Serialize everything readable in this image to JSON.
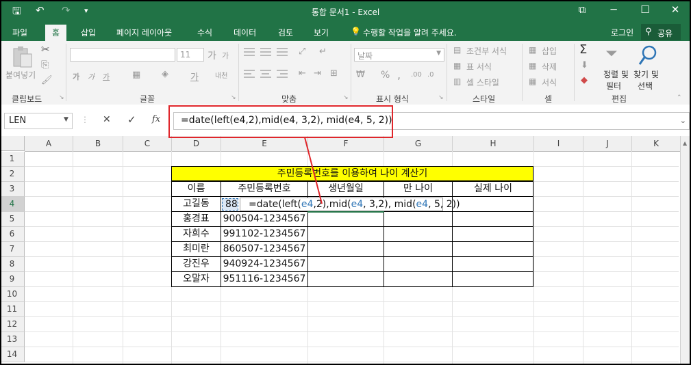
{
  "window": {
    "title": "통합 문서1 - Excel",
    "qat_save": "🖫",
    "qat_undo": "↶",
    "qat_redo": "↷",
    "qat_more": "▾",
    "btn_restore": "⧉",
    "btn_min": "─",
    "btn_max": "☐",
    "btn_close": "✕"
  },
  "tabs": [
    "파일",
    "홈",
    "삽입",
    "페이지 레이아웃",
    "수식",
    "데이터",
    "검토",
    "보기"
  ],
  "tell_me": "수행할 작업을 알려 주세요.",
  "account": {
    "signin": "로그인",
    "share": "공유"
  },
  "ribbon": {
    "clipboard": {
      "paste": "붙여넣기",
      "label": "클립보드"
    },
    "font": {
      "size": "11",
      "grow": "가",
      "shrink": "가",
      "bold": "가",
      "italic": "가",
      "underline": "가",
      "phonetic": "내천",
      "label": "글꼴"
    },
    "alignment": {
      "label": "맞춤"
    },
    "number": {
      "format": "날짜",
      "percent": "%",
      "comma": ",",
      "label": "표시 형식"
    },
    "styles": {
      "conditional": "조건부 서식",
      "table": "표 서식",
      "cell": "셀 스타일",
      "label": "스타일"
    },
    "cells": {
      "insert": "삽입",
      "delete": "삭제",
      "format": "서식",
      "label": "셀"
    },
    "editing": {
      "sort": "정렬 및",
      "filter": "필터",
      "find": "찾기 및",
      "select": "선택",
      "label": "편집"
    }
  },
  "formula_bar": {
    "name_box": "LEN",
    "cancel": "✕",
    "enter": "✓",
    "fx": "fx",
    "formula": "=date(left(e4,2),mid(e4, 3,2), mid(e4, 5, 2))"
  },
  "columns": [
    "A",
    "B",
    "C",
    "D",
    "E",
    "F",
    "G",
    "H",
    "I",
    "J",
    "K"
  ],
  "rows": [
    "1",
    "2",
    "3",
    "4",
    "5",
    "6",
    "7",
    "8",
    "9",
    "10",
    "11",
    "12",
    "13",
    "14"
  ],
  "sheet": {
    "banner": "주민등록번호를 이용하여 나이 계산기",
    "headers": [
      "이름",
      "주민등록번호",
      "생년월일",
      "만 나이",
      "실제 나이"
    ],
    "records": [
      {
        "name": "고길동",
        "id": "88"
      },
      {
        "name": "홍경표",
        "id": "900504-1234567"
      },
      {
        "name": "자희수",
        "id": "991102-1234567"
      },
      {
        "name": "최미란",
        "id": "860507-1234567"
      },
      {
        "name": "강진우",
        "id": "940924-1234567"
      },
      {
        "name": "오말자",
        "id": "951116-1234567"
      }
    ],
    "edit": {
      "p1": "=date(left(",
      "r1": "e4",
      "p2": ",2),mid(",
      "r2": "e4",
      "p3": ", 3,2), mid(",
      "r3": "e4",
      "p4": ", 5, 2))"
    }
  },
  "colors": {
    "excel_green": "#217346",
    "banner_yellow": "#ffff00",
    "callout_red": "#e0262b",
    "ref_blue": "#2e75b6"
  }
}
